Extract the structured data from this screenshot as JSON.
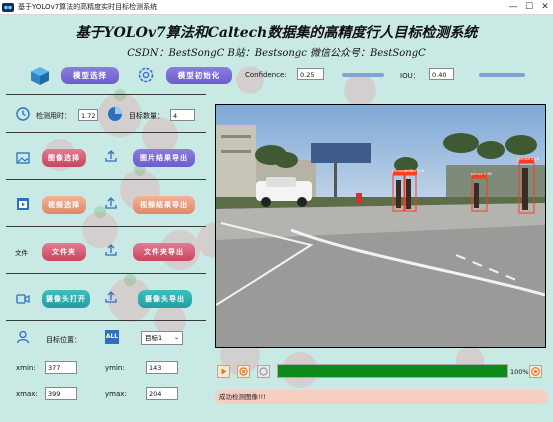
{
  "window": {
    "title": "基于YOLOv7算法的高精度实时目标检测系统",
    "minimize_glyph": "—",
    "maximize_glyph": "☐",
    "close_glyph": "✕"
  },
  "header": {
    "title": "基于YOLOv7算法和Caltech数据集的高精度行人目标检测系统",
    "subtitle": "CSDN：BestSongC   B站：Bestsongc   微信公众号：BestSongC"
  },
  "model_bar": {
    "select_model_label": "模型选择",
    "init_model_label": "模型初始化",
    "confidence_label": "Confidence:",
    "confidence_value": "0.25",
    "iou_label": "IOU：",
    "iou_value": "0.40"
  },
  "stats": {
    "time_label": "检测用时：",
    "time_value": "1.72",
    "count_label": "目标数量：",
    "count_value": "4"
  },
  "image_row": {
    "select_label": "图像选择",
    "export_label": "图片结果导出"
  },
  "video_row": {
    "select_label": "视频选择",
    "export_label": "视频结果导出"
  },
  "folder_row": {
    "icon_text": "文件",
    "select_label": "文件夹",
    "export_label": "文件夹导出"
  },
  "camera_row": {
    "open_label": "摄像头打开",
    "export_label": "摄像头导出"
  },
  "target": {
    "position_label": "目标位置：",
    "all_badge": "ALL",
    "selected_target": "目标1",
    "xmin_label": "xmin:",
    "xmin_value": "377",
    "ymin_label": "ymin:",
    "ymin_value": "143",
    "xmax_label": "xmax:",
    "xmax_value": "399",
    "ymax_label": "ymax:",
    "ymax_value": "204"
  },
  "player": {
    "progress_text": "100%",
    "progress": 1.0,
    "detections": [
      "person 0.78",
      "person 0.81",
      "person 0.80",
      "person 0.76"
    ]
  },
  "status": {
    "message": "成功检测图像!!!"
  },
  "colors": {
    "background": "#c9e9e4",
    "purple_button": "#7a6bd6",
    "red_button": "#d8566f",
    "orange_button": "#e8987a",
    "teal_button": "#2eb0b1",
    "progress_fill": "#0d8a1a",
    "status_bar": "#f5cfc0",
    "detection_box": "#ff3b1f"
  }
}
